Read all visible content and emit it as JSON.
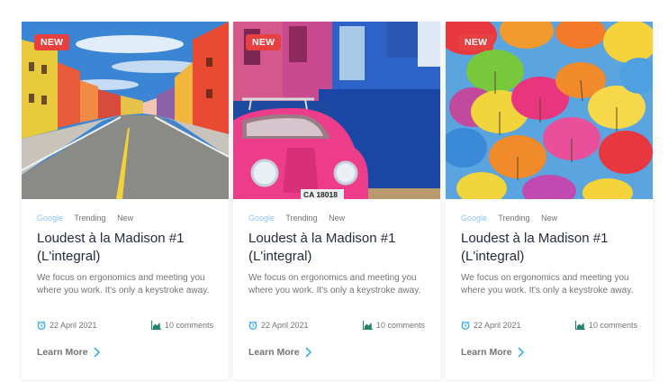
{
  "cards": [
    {
      "badge": "NEW",
      "tags": [
        "Google",
        "Trending",
        "New"
      ],
      "title": "Loudest à la Madison #1 (L'integral)",
      "description": "We focus on ergonomics and meeting you where you work. It's only a keystroke away.",
      "date": "22 April 2021",
      "comments": "10 comments",
      "cta": "Learn More",
      "image": "colorful-street-photo"
    },
    {
      "badge": "NEW",
      "tags": [
        "Google",
        "Trending",
        "New"
      ],
      "title": "Loudest à la Madison #1 (L'integral)",
      "description": "We focus on ergonomics and meeting you where you work. It's only a keystroke away.",
      "date": "22 April 2021",
      "comments": "10 comments",
      "cta": "Learn More",
      "image": "pink-beetle-car-photo",
      "plate": "CA 18018"
    },
    {
      "badge": "NEW",
      "tags": [
        "Google",
        "Trending",
        "New"
      ],
      "title": "Loudest à la Madison #1 (L'integral)",
      "description": "We focus on ergonomics and meeting you where you work. It's only a keystroke away.",
      "date": "22 April 2021",
      "comments": "10 comments",
      "cta": "Learn More",
      "image": "colorful-umbrellas-photo"
    }
  ],
  "icons": {
    "date": "alarm-clock-icon",
    "comments": "area-chart-icon",
    "cta": "chevron-right-icon"
  },
  "colors": {
    "badge": "#e74040",
    "tag_highlight": "#8ec2f2",
    "title": "#252b42",
    "text": "#737373",
    "icon": "#23a6f0",
    "chart_icon": "#23856d"
  }
}
